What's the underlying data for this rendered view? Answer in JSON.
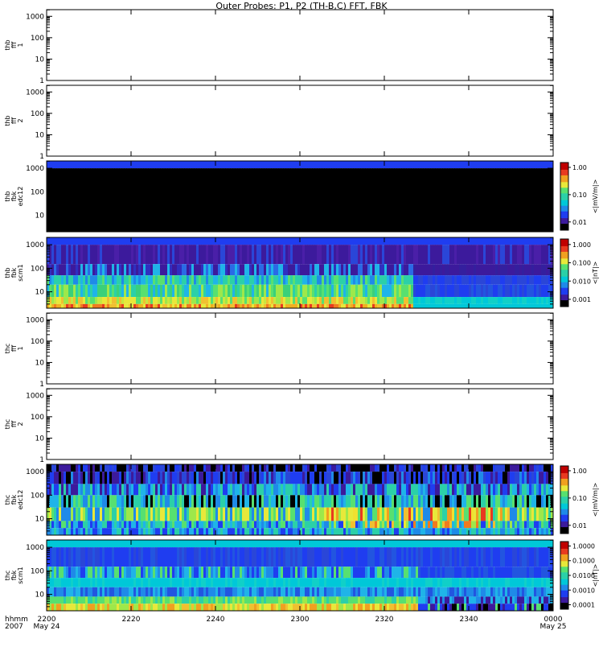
{
  "title": "Outer Probes: P1, P2 (TH-B,C) FFT, FBK",
  "x_axis": {
    "corner_labels": [
      "hhmm",
      "2007"
    ],
    "ticks": [
      "2200",
      "2220",
      "2240",
      "2300",
      "2320",
      "2340",
      "0000"
    ],
    "date_labels": [
      {
        "text": "May 24",
        "tick": 0
      },
      {
        "text": "May 25",
        "tick": 6
      }
    ]
  },
  "chart_data": [
    {
      "type": "heatmap",
      "ylabel": [
        "thb",
        "fff",
        "1"
      ],
      "ylim": [
        1,
        2048
      ],
      "yscale": "log",
      "yticks": [
        "1",
        "10",
        "100",
        "1000"
      ],
      "empty": true
    },
    {
      "type": "heatmap",
      "ylabel": [
        "thb",
        "fff",
        "2"
      ],
      "ylim": [
        1,
        2048
      ],
      "yscale": "log",
      "yticks": [
        "1",
        "10",
        "100",
        "1000"
      ],
      "empty": true
    },
    {
      "type": "heatmap",
      "ylabel": [
        "thb",
        "fbk",
        "edc12"
      ],
      "ylim": [
        2,
        2048
      ],
      "yscale": "log",
      "yticks": [
        "10",
        "100",
        "1000"
      ],
      "colorbar": {
        "label": "<|mV/m|>",
        "ticks": [
          "0.01",
          "0.10",
          "1.00"
        ],
        "range": [
          0.005,
          1.5
        ],
        "scale": "log"
      },
      "bands": [
        {
          "fmin": 1000,
          "fmax": 2048,
          "pattern": "uniform",
          "colors": [
            "#1f3df0"
          ]
        },
        {
          "fmin": 2,
          "fmax": 1000,
          "pattern": "uniform",
          "colors": [
            "#000000"
          ]
        }
      ]
    },
    {
      "type": "heatmap",
      "ylabel": [
        "thb",
        "fbk",
        "scm1"
      ],
      "ylim": [
        2,
        2048
      ],
      "yscale": "log",
      "yticks": [
        "10",
        "100",
        "1000"
      ],
      "colorbar": {
        "label": "<|nT|>",
        "ticks": [
          "0.001",
          "0.010",
          "0.100",
          "1.000"
        ],
        "range": [
          0.0004,
          2
        ],
        "scale": "log"
      },
      "bands": [
        {
          "fmin": 1000,
          "fmax": 2048,
          "pattern": "uniform",
          "colors": [
            "#1f3df0"
          ]
        },
        {
          "fmin": 150,
          "fmax": 1000,
          "pattern": "mix",
          "colors": [
            "#3c1a9c",
            "#3c1a9c",
            "#4a1fa8",
            "#2a46d8",
            "#3c1a9c"
          ]
        },
        {
          "fmin": 50,
          "fmax": 150,
          "pattern": "mix",
          "colors": [
            "#3c1a9c",
            "#2f2fc0",
            "#2a6ae6",
            "#1fb4e8",
            "#3c1a9c"
          ],
          "after": [
            "#3c1a9c",
            "#341f9e"
          ]
        },
        {
          "fmin": 20,
          "fmax": 50,
          "pattern": "mix",
          "colors": [
            "#2bd0a8",
            "#1fb4e8",
            "#2bd0a8",
            "#57e070",
            "#1f8ae8"
          ],
          "after": [
            "#1f3df0",
            "#2a46d8"
          ]
        },
        {
          "fmin": 6,
          "fmax": 20,
          "pattern": "mix",
          "colors": [
            "#57e070",
            "#3ad07a",
            "#9ee84a",
            "#1fb4e8",
            "#2bd0a8"
          ],
          "after": [
            "#1f3df0",
            "#2255e0",
            "#2a46d8"
          ]
        },
        {
          "fmin": 3,
          "fmax": 6,
          "pattern": "mix",
          "colors": [
            "#e8e83a",
            "#c8e840",
            "#57e070",
            "#f0c030",
            "#9ee84a"
          ],
          "after": [
            "#00c8d8",
            "#10d0c8"
          ]
        },
        {
          "fmin": 2,
          "fmax": 3,
          "pattern": "mix",
          "colors": [
            "#f0b020",
            "#f07a20",
            "#e8e83a",
            "#e83a20",
            "#f0c030"
          ],
          "after": [
            "#00c8d8"
          ]
        }
      ],
      "transition_fraction": 0.72
    },
    {
      "type": "heatmap",
      "ylabel": [
        "thc",
        "fff",
        "1"
      ],
      "ylim": [
        1,
        2048
      ],
      "yscale": "log",
      "yticks": [
        "1",
        "10",
        "100",
        "1000"
      ],
      "empty": true
    },
    {
      "type": "heatmap",
      "ylabel": [
        "thc",
        "fff",
        "2"
      ],
      "ylim": [
        1,
        2048
      ],
      "yscale": "log",
      "yticks": [
        "1",
        "10",
        "100",
        "1000"
      ],
      "empty": true
    },
    {
      "type": "heatmap",
      "ylabel": [
        "thc",
        "fbk",
        "edc12"
      ],
      "ylim": [
        2,
        2048
      ],
      "yscale": "log",
      "yticks": [
        "10",
        "100",
        "1000"
      ],
      "colorbar": {
        "label": "<|mV/m|>",
        "ticks": [
          "0.01",
          "0.10",
          "1.00"
        ],
        "range": [
          0.005,
          1.5
        ],
        "scale": "log"
      },
      "bands": [
        {
          "fmin": 1000,
          "fmax": 2048,
          "pattern": "mix",
          "colors": [
            "#000000",
            "#1f3df0",
            "#3c1a9c",
            "#000000",
            "#2a46d8"
          ]
        },
        {
          "fmin": 300,
          "fmax": 1000,
          "pattern": "mix",
          "colors": [
            "#1f3df0",
            "#3c1a9c",
            "#1f8ae8",
            "#000000",
            "#2a46d8"
          ]
        },
        {
          "fmin": 100,
          "fmax": 300,
          "pattern": "mix",
          "colors": [
            "#1fb4e8",
            "#1f8ae8",
            "#2bd0a8",
            "#1f3df0",
            "#3c1a9c"
          ]
        },
        {
          "fmin": 30,
          "fmax": 100,
          "pattern": "mix",
          "colors": [
            "#2bd0a8",
            "#57e070",
            "#1fb4e8",
            "#000000",
            "#1f8ae8"
          ]
        },
        {
          "fmin": 8,
          "fmax": 30,
          "pattern": "mix",
          "colors": [
            "#57e070",
            "#9ee84a",
            "#2bd0a8",
            "#1f8ae8",
            "#e8e83a"
          ],
          "hot": [
            "#f0e030",
            "#f0c030",
            "#e8e83a",
            "#f0a020",
            "#e83a20"
          ]
        },
        {
          "fmin": 4,
          "fmax": 8,
          "pattern": "mix",
          "colors": [
            "#1f8ae8",
            "#2bd0a8",
            "#1f3df0",
            "#57e070",
            "#1fb4e8"
          ],
          "hot": [
            "#e8e83a",
            "#f0c030",
            "#f07a20",
            "#9ee84a"
          ]
        },
        {
          "fmin": 2,
          "fmax": 4,
          "pattern": "mix",
          "colors": [
            "#1fb4e8",
            "#1f8ae8",
            "#2bd0a8",
            "#1f3df0"
          ]
        }
      ],
      "hot_range": [
        0.55,
        0.92
      ]
    },
    {
      "type": "heatmap",
      "ylabel": [
        "thc",
        "fbk",
        "scm1"
      ],
      "ylim": [
        2,
        2048
      ],
      "yscale": "log",
      "yticks": [
        "10",
        "100",
        "1000"
      ],
      "colorbar": {
        "label": "<|nT|>",
        "ticks": [
          "0.0001",
          "0.0010",
          "0.0100",
          "0.1000",
          "1.0000"
        ],
        "range": [
          5e-05,
          2
        ],
        "scale": "log"
      },
      "bands": [
        {
          "fmin": 1000,
          "fmax": 2048,
          "pattern": "uniform",
          "colors": [
            "#00c8d8"
          ]
        },
        {
          "fmin": 150,
          "fmax": 1000,
          "pattern": "mix",
          "colors": [
            "#1f3df0",
            "#2a46d8",
            "#1f3df0",
            "#2255e0"
          ]
        },
        {
          "fmin": 50,
          "fmax": 150,
          "pattern": "mix",
          "colors": [
            "#1f8ae8",
            "#1f3df0",
            "#1fb4e8",
            "#57e070"
          ],
          "after": [
            "#1f3df0",
            "#2255e0"
          ]
        },
        {
          "fmin": 20,
          "fmax": 50,
          "pattern": "mix",
          "colors": [
            "#00c8d8",
            "#10d0c8",
            "#00c8d8"
          ]
        },
        {
          "fmin": 8,
          "fmax": 20,
          "pattern": "mix",
          "colors": [
            "#1f8ae8",
            "#1fb4e8",
            "#2255e0"
          ]
        },
        {
          "fmin": 4,
          "fmax": 8,
          "pattern": "mix",
          "colors": [
            "#57e070",
            "#9ee84a",
            "#2bd0a8",
            "#57e070"
          ],
          "after": [
            "#1fb4e8",
            "#1f8ae8",
            "#3c1a9c"
          ]
        },
        {
          "fmin": 2,
          "fmax": 4,
          "pattern": "mix",
          "colors": [
            "#e8e83a",
            "#f0c030",
            "#9ee84a",
            "#f0a020"
          ],
          "after": [
            "#1f3df0",
            "#3c1a9c",
            "#000000",
            "#57e070"
          ]
        }
      ],
      "transition_fraction": 0.73
    }
  ],
  "colormap": [
    "#000000",
    "#3c1a9c",
    "#1f3df0",
    "#1f8ae8",
    "#00c8d8",
    "#2bd0a8",
    "#57e070",
    "#e8e83a",
    "#f0a020",
    "#e83a20",
    "#c00000"
  ]
}
